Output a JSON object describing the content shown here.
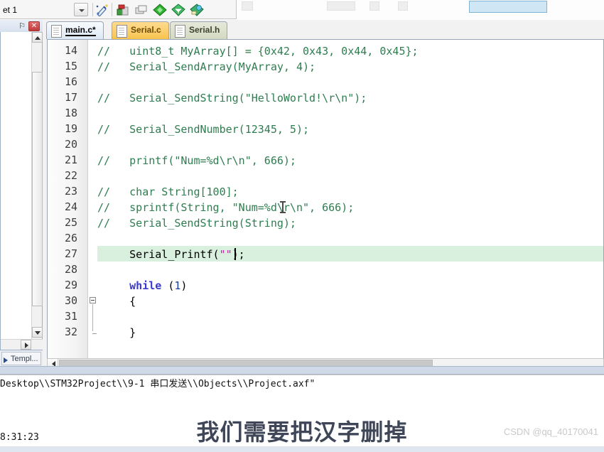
{
  "toolbar": {
    "target_label": "et 1",
    "target_dropdown_name": "target-select",
    "icons": [
      {
        "name": "wand-icon",
        "title": "Configuration Wizard"
      },
      {
        "name": "target-options-icon",
        "title": "Options for Target"
      },
      {
        "name": "manage-components-icon",
        "title": "Manage Project Items"
      },
      {
        "name": "pack-installer-green-icon",
        "title": "Pack Installer"
      },
      {
        "name": "pack-filter-icon",
        "title": "Select Software Packs"
      },
      {
        "name": "run-time-environment-icon",
        "title": "Manage Run-Time Environment"
      }
    ]
  },
  "project_panel": {
    "pin_glyph": "⚐",
    "close_glyph": "✕",
    "bottom_tab_label": "Templ..."
  },
  "tabs": [
    {
      "label": "main.c*",
      "state": "active",
      "name": "editor-tab-main-c"
    },
    {
      "label": "Serial.c",
      "state": "modified",
      "name": "editor-tab-serial-c"
    },
    {
      "label": "Serial.h",
      "state": "normal",
      "name": "editor-tab-serial-h"
    }
  ],
  "editor": {
    "first_line_number": 14,
    "highlighted_line": 27,
    "fold_open_line": 30,
    "fold_end_line": 32,
    "lines": [
      {
        "n": 14,
        "tokens": [
          {
            "t": "//   uint8_t MyArray[] = {0x42, 0x43, 0x44, 0x45};",
            "c": "cmt"
          }
        ]
      },
      {
        "n": 15,
        "tokens": [
          {
            "t": "//   Serial_SendArray(MyArray, 4);",
            "c": "cmt"
          }
        ]
      },
      {
        "n": 16,
        "tokens": [
          {
            "t": "",
            "c": "plain"
          }
        ]
      },
      {
        "n": 17,
        "tokens": [
          {
            "t": "//   Serial_SendString(\"HelloWorld!\\r\\n\");",
            "c": "cmt"
          }
        ]
      },
      {
        "n": 18,
        "tokens": [
          {
            "t": "",
            "c": "plain"
          }
        ]
      },
      {
        "n": 19,
        "tokens": [
          {
            "t": "//   Serial_SendNumber(12345, 5);",
            "c": "cmt"
          }
        ]
      },
      {
        "n": 20,
        "tokens": [
          {
            "t": "",
            "c": "plain"
          }
        ]
      },
      {
        "n": 21,
        "tokens": [
          {
            "t": "//   printf(\"Num=%d\\r\\n\", 666);",
            "c": "cmt"
          }
        ]
      },
      {
        "n": 22,
        "tokens": [
          {
            "t": "",
            "c": "plain"
          }
        ]
      },
      {
        "n": 23,
        "tokens": [
          {
            "t": "//   char String[100];",
            "c": "cmt"
          }
        ]
      },
      {
        "n": 24,
        "tokens": [
          {
            "t": "//   sprintf(String, \"Num=%d\\r\\n\", 666);",
            "c": "cmt"
          }
        ]
      },
      {
        "n": 25,
        "tokens": [
          {
            "t": "//   Serial_SendString(String);",
            "c": "cmt"
          }
        ]
      },
      {
        "n": 26,
        "tokens": [
          {
            "t": "",
            "c": "plain"
          }
        ]
      },
      {
        "n": 27,
        "tokens": [
          {
            "t": "     Serial_Printf(",
            "c": "plain"
          },
          {
            "t": "\"\"",
            "c": "str"
          },
          {
            "t": ");",
            "c": "plain"
          }
        ]
      },
      {
        "n": 28,
        "tokens": [
          {
            "t": "",
            "c": "plain"
          }
        ]
      },
      {
        "n": 29,
        "tokens": [
          {
            "t": "     ",
            "c": "plain"
          },
          {
            "t": "while",
            "c": "kw"
          },
          {
            "t": " ",
            "c": "plain"
          },
          {
            "t": "(",
            "c": "punct"
          },
          {
            "t": "1",
            "c": "num"
          },
          {
            "t": ")",
            "c": "punct"
          }
        ]
      },
      {
        "n": 30,
        "tokens": [
          {
            "t": "     {",
            "c": "plain"
          }
        ]
      },
      {
        "n": 31,
        "tokens": [
          {
            "t": "",
            "c": "plain"
          }
        ]
      },
      {
        "n": 32,
        "tokens": [
          {
            "t": "     }",
            "c": "plain"
          }
        ]
      }
    ]
  },
  "build_output": {
    "line": "Desktop\\\\STM32Project\\\\9-1 串口发送\\\\Objects\\\\Project.axf\""
  },
  "status_bar": {
    "time": "8:31:23"
  },
  "overlay": {
    "subtitle": "我们需要把汉字删掉",
    "watermark": "CSDN @qq_40170041"
  },
  "colors": {
    "comment": "#2e7d4f",
    "keyword": "#3a3ad0",
    "string": "#c026a8",
    "number": "#1a3fa0",
    "highlight_row": "#d8f0dd",
    "tab_active": "#dce8f5",
    "tab_modified": "#f8c44e",
    "tab_header": "#d3d9c2",
    "subtitle": "#3e4657",
    "watermark": "#c9c9c9"
  }
}
